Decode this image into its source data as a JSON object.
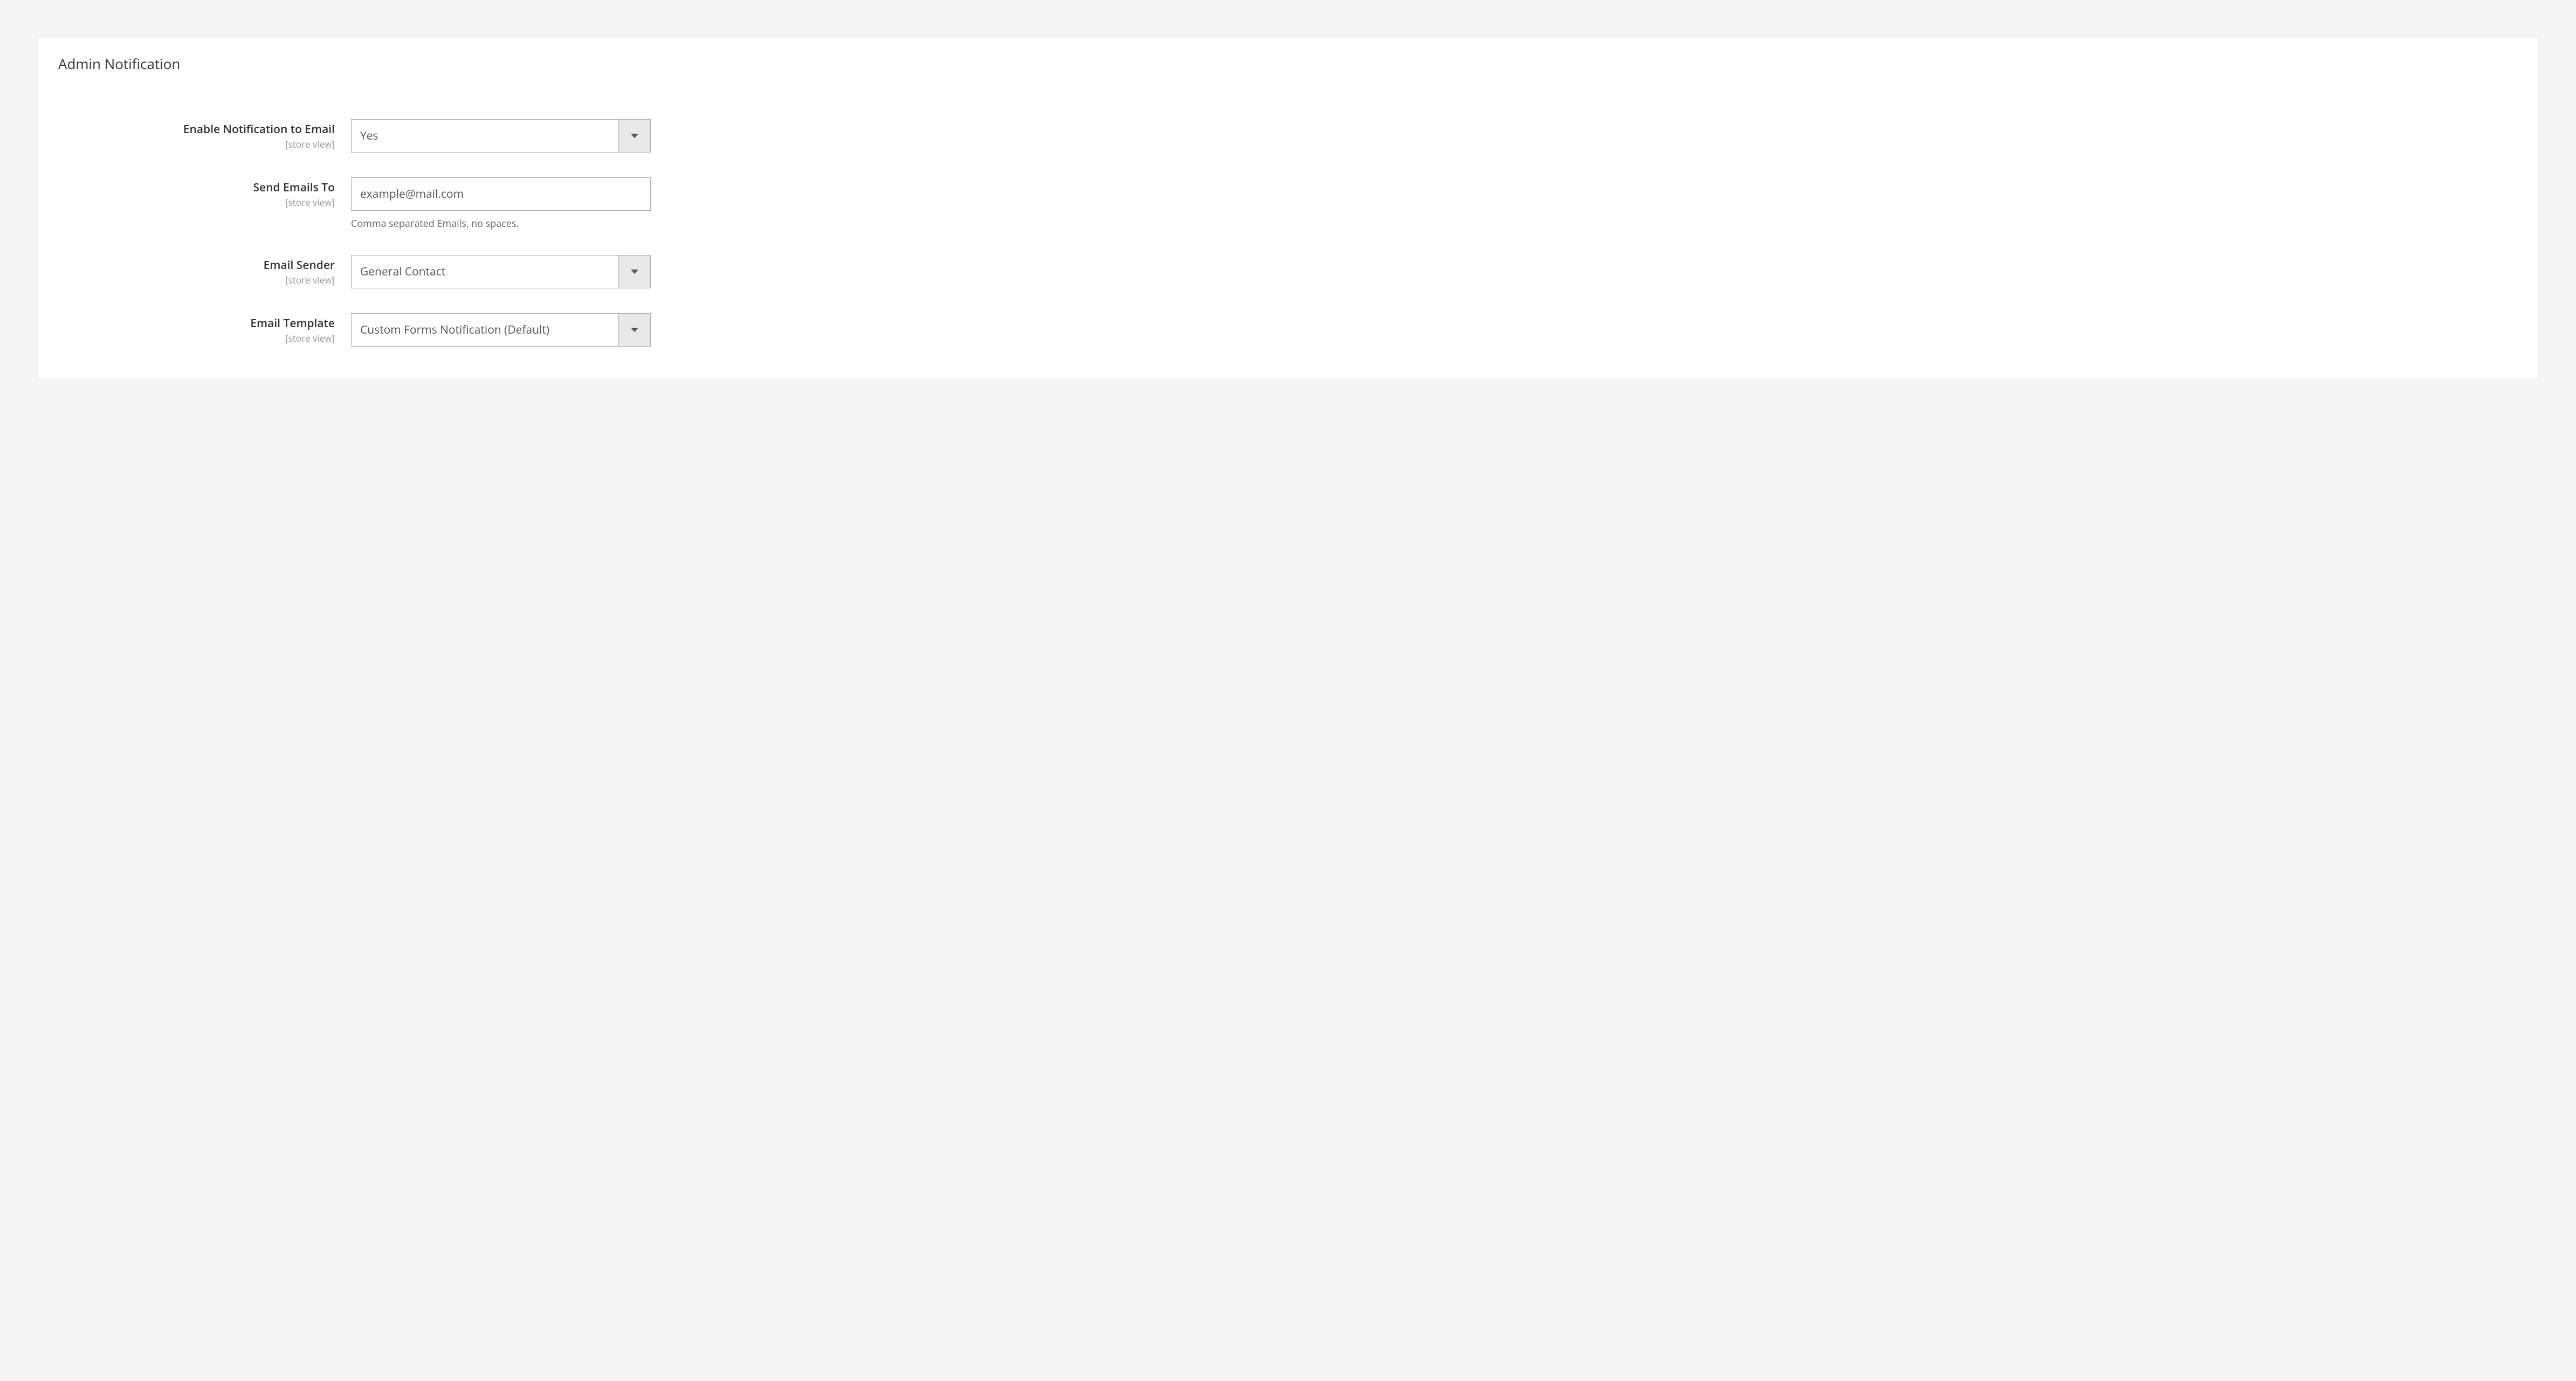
{
  "section": {
    "title": "Admin Notification"
  },
  "fields": {
    "enable_notification": {
      "label": "Enable Notification to Email",
      "scope": "[store view]",
      "value": "Yes"
    },
    "send_emails_to": {
      "label": "Send Emails To",
      "scope": "[store view]",
      "value": "example@mail.com",
      "help": "Comma separated Emails, no spaces."
    },
    "email_sender": {
      "label": "Email Sender",
      "scope": "[store view]",
      "value": "General Contact"
    },
    "email_template": {
      "label": "Email Template",
      "scope": "[store view]",
      "value": "Custom Forms Notification (Default)"
    }
  }
}
